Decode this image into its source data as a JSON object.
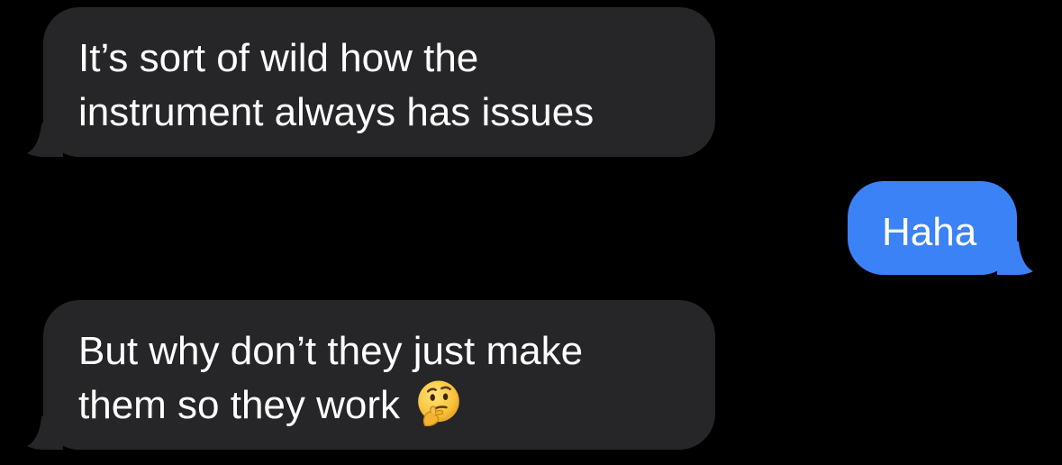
{
  "conversation": {
    "messages": [
      {
        "direction": "incoming",
        "lines": [
          "It’s sort of wild how the",
          "instrument always has issues"
        ]
      },
      {
        "direction": "outgoing",
        "lines": [
          "Haha"
        ]
      },
      {
        "direction": "incoming",
        "lines": [
          "But why don’t they just make",
          "them so they work"
        ],
        "emoji": "thinking-face-icon"
      }
    ]
  },
  "colors": {
    "background": "#000000",
    "incoming_bubble": "#262629",
    "outgoing_bubble": "#3b82f6",
    "text": "#ffffff"
  }
}
